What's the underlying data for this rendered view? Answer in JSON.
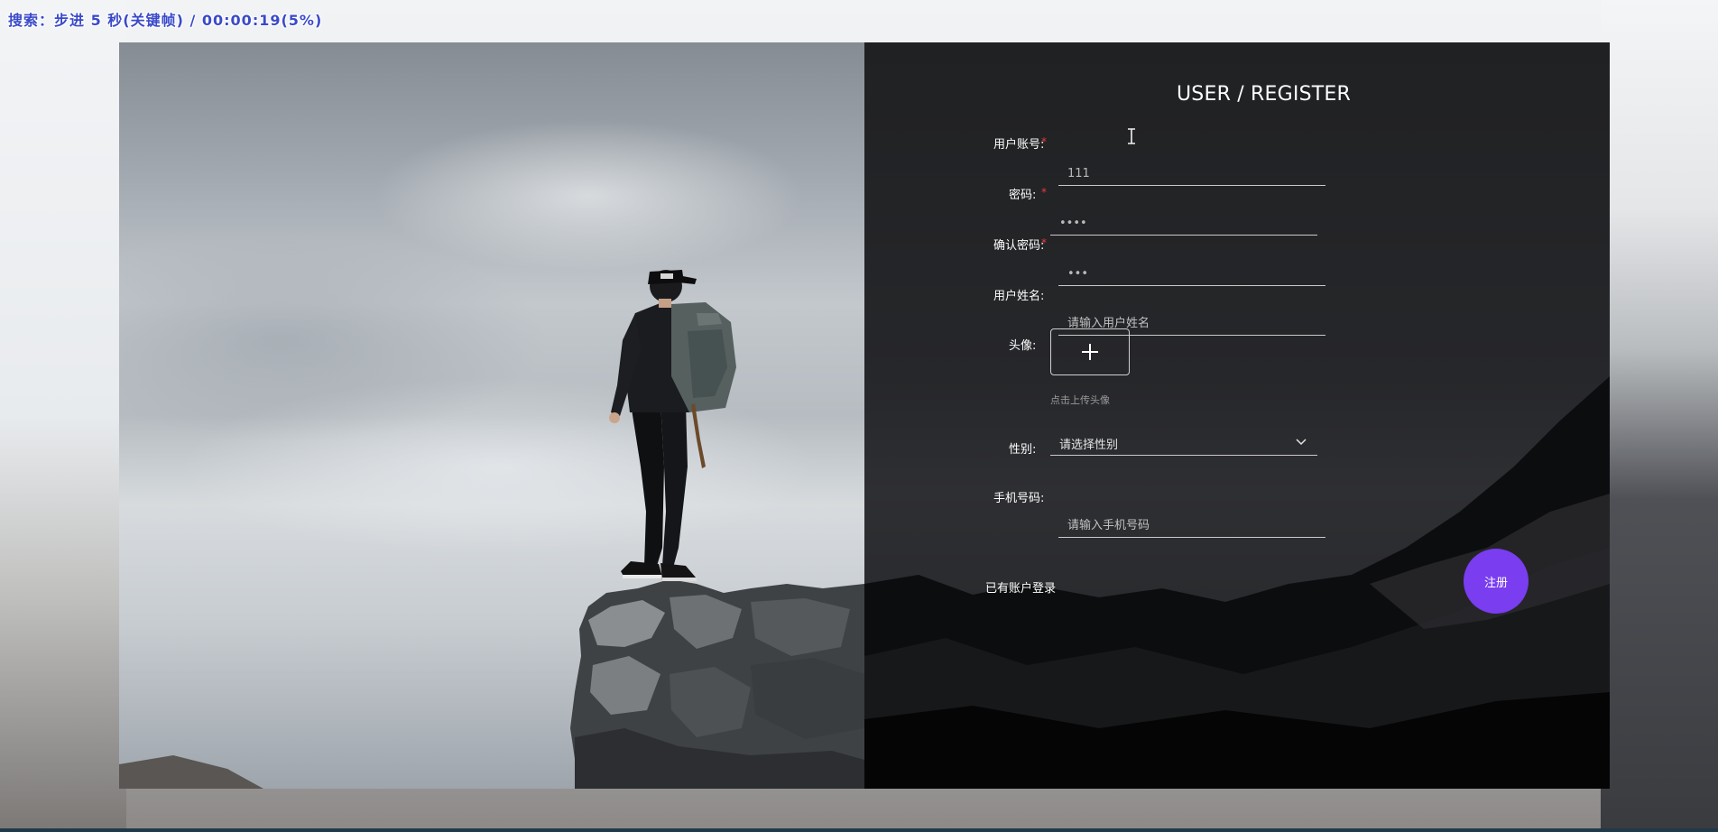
{
  "status_bar": {
    "text": "搜索：步进 5 秒(关键帧) / 00:00:19(5%)"
  },
  "form": {
    "title": "USER / REGISTER",
    "fields": [
      {
        "label": "用户账号:",
        "required": true,
        "value": "111",
        "placeholder": ""
      },
      {
        "label": "密码:",
        "required": true,
        "value": "••••",
        "placeholder": ""
      },
      {
        "label": "确认密码:",
        "required": true,
        "value": "•••",
        "placeholder": ""
      },
      {
        "label": "用户姓名:",
        "required": false,
        "value": "",
        "placeholder": "请输入用户姓名"
      }
    ],
    "avatar": {
      "label": "头像:",
      "hint": "点击上传头像"
    },
    "gender": {
      "label": "性别:",
      "selected": "请选择性别"
    },
    "phone": {
      "label": "手机号码:",
      "placeholder": "请输入手机号码"
    },
    "login_link": "已有账户登录",
    "register_button": "注册"
  },
  "colors": {
    "accent": "#7a3df0",
    "required_mark": "#e83b3b",
    "panel_bg": "#222326",
    "status_text": "#3a4ac8"
  },
  "icons": {
    "upload": "plus-icon",
    "select": "chevron-down-icon",
    "cursor": "text-cursor-icon"
  }
}
